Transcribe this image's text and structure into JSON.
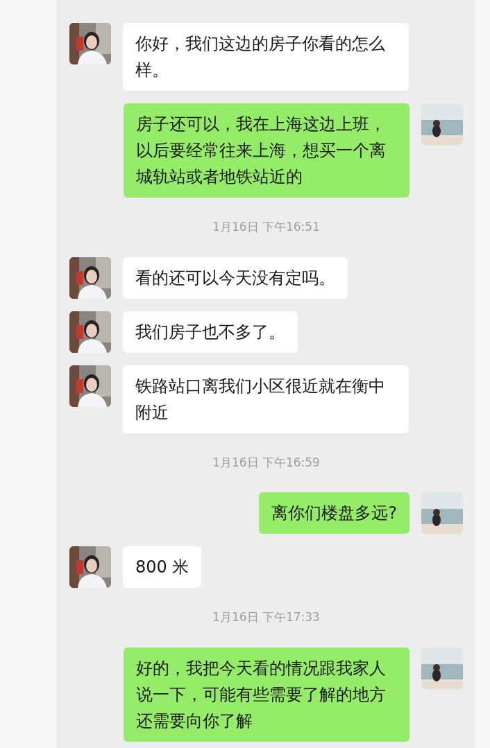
{
  "messages": [
    {
      "kind": "message",
      "outgoing": false,
      "text": "你好，我们这边的房子你看的怎么样。"
    },
    {
      "kind": "message",
      "outgoing": true,
      "text": "房子还可以，我在上海这边上班，以后要经常往来上海，想买一个离城轨站或者地铁站近的"
    },
    {
      "kind": "timestamp",
      "text": "1月16日 下午16:51"
    },
    {
      "kind": "message",
      "outgoing": false,
      "text": "看的还可以今天没有定吗。"
    },
    {
      "kind": "message",
      "outgoing": false,
      "text": "我们房子也不多了。"
    },
    {
      "kind": "message",
      "outgoing": false,
      "text": "铁路站口离我们小区很近就在衡中附近"
    },
    {
      "kind": "timestamp",
      "text": "1月16日 下午16:59"
    },
    {
      "kind": "message",
      "outgoing": true,
      "text": "离你们楼盘多远?"
    },
    {
      "kind": "message",
      "outgoing": false,
      "text": "800 米"
    },
    {
      "kind": "timestamp",
      "text": "1月16日 下午17:33"
    },
    {
      "kind": "message",
      "outgoing": true,
      "text": "好的，我把今天看的情况跟我家人说一下，可能有些需要了解的地方还需要向你了解"
    }
  ]
}
